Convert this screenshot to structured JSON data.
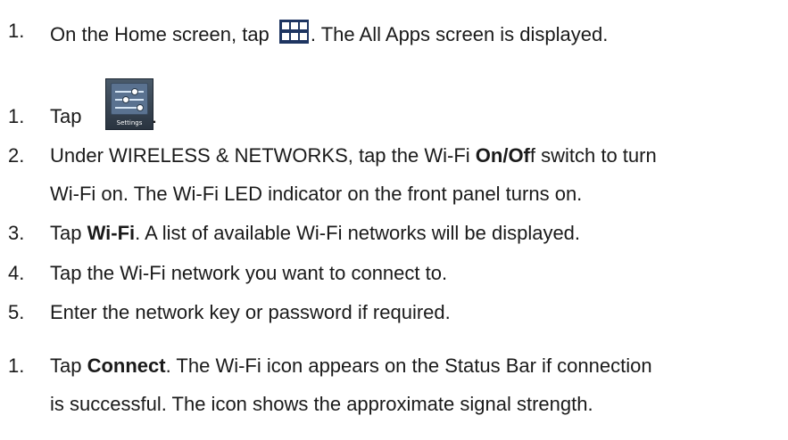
{
  "steps": [
    {
      "num": "1.",
      "before": "On the Home screen, tap ",
      "after": ". The All Apps screen is displayed."
    },
    {
      "num": "1.",
      "before": "Tap ",
      "after": "."
    },
    {
      "num": "2.",
      "t1": "Under WIRELESS & NETWORKS, tap the Wi-Fi ",
      "b1": "On/Of",
      "t2": "f switch to turn",
      "cont": "Wi-Fi on. The Wi-Fi LED indicator on the front panel turns on."
    },
    {
      "num": "3.",
      "t1": "Tap ",
      "b1": "Wi-Fi",
      "t2": ". A list of available Wi-Fi networks will be displayed."
    },
    {
      "num": "4.",
      "text": "Tap the Wi-Fi network you want to connect to."
    },
    {
      "num": "5.",
      "text": "Enter the network key or password if required."
    },
    {
      "num": "1.",
      "t1": "Tap ",
      "b1": "Connect",
      "t2": ". The Wi-Fi icon appears on the Status Bar if connection",
      "cont": "is successful. The icon shows the approximate signal strength."
    }
  ],
  "icons": {
    "apps": "all-apps-grid-icon",
    "settings": "settings-icon",
    "settings_caption": "Settings"
  }
}
